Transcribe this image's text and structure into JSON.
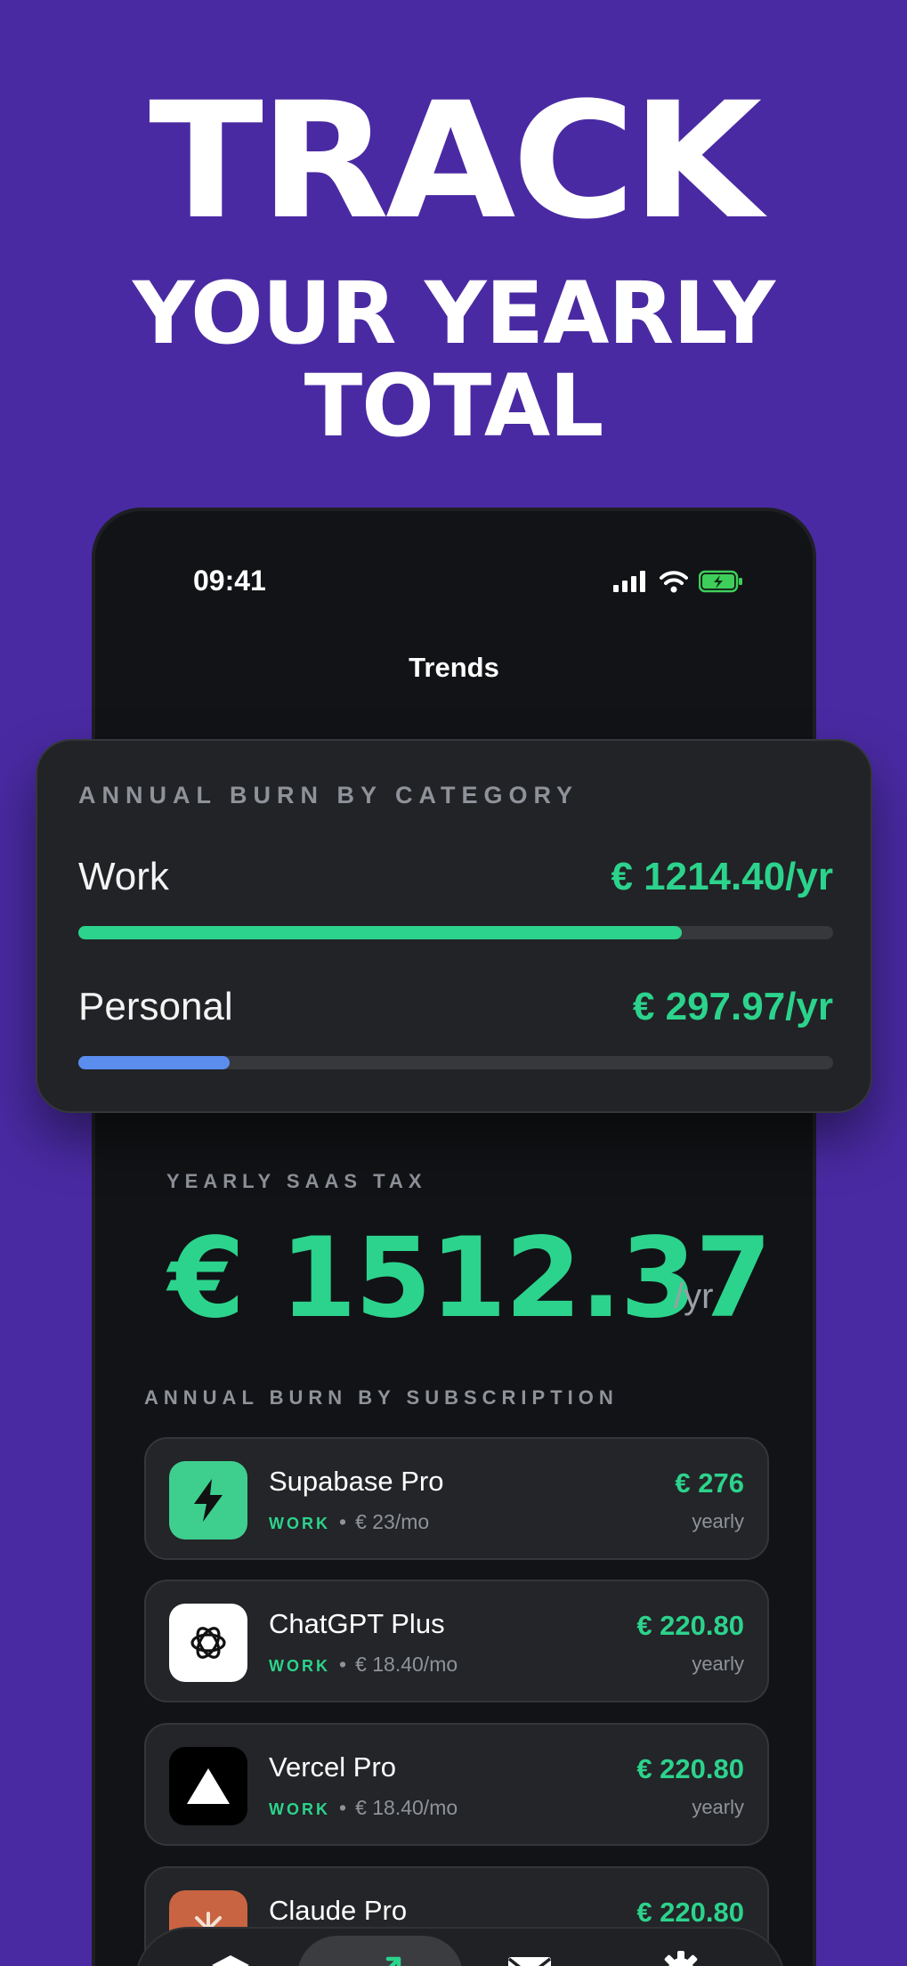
{
  "headline": {
    "line1": "TRACK",
    "line2a": "YOUR YEARLY",
    "line2b": "TOTAL"
  },
  "status_bar": {
    "time": "09:41"
  },
  "nav": {
    "title": "Trends"
  },
  "category_card": {
    "title": "ANNUAL BURN BY CATEGORY",
    "rows": [
      {
        "label": "Work",
        "value": "€ 1214.40/yr",
        "fraction": 0.8,
        "color": "#2cd38c"
      },
      {
        "label": "Personal",
        "value": "€ 297.97/yr",
        "fraction": 0.2,
        "color": "#5b8def"
      }
    ]
  },
  "yearly_tax": {
    "label": "YEARLY SAAS TAX",
    "value": "€ 1512.37",
    "unit": "/yr"
  },
  "subscriptions": {
    "label": "ANNUAL BURN BY SUBSCRIPTION",
    "items": [
      {
        "name": "Supabase Pro",
        "category": "WORK",
        "monthly": "€ 23/mo",
        "yearly_price": "€ 276",
        "period": "yearly",
        "icon": "bolt-icon",
        "logo_bg": "#3ecf8e"
      },
      {
        "name": "ChatGPT Plus",
        "category": "WORK",
        "monthly": "€ 18.40/mo",
        "yearly_price": "€ 220.80",
        "period": "yearly",
        "icon": "openai-icon",
        "logo_bg": "#ffffff"
      },
      {
        "name": "Vercel Pro",
        "category": "WORK",
        "monthly": "€ 18.40/mo",
        "yearly_price": "€ 220.80",
        "period": "yearly",
        "icon": "triangle-icon",
        "logo_bg": "#000000"
      },
      {
        "name": "Claude Pro",
        "category": "",
        "monthly": "",
        "yearly_price": "€ 220.80",
        "period": "",
        "icon": "claude-icon",
        "logo_bg": "#c96442"
      }
    ]
  },
  "tabbar": {
    "tabs": [
      "layers-icon",
      "trends-icon",
      "mail-icon",
      "gear-icon"
    ],
    "active": "trends-icon"
  }
}
